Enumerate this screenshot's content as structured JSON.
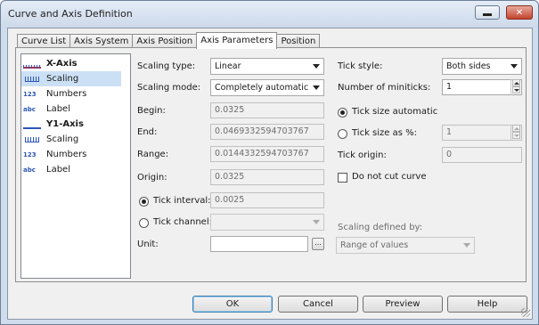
{
  "window": {
    "title": "Curve and Axis Definition"
  },
  "tabs": [
    {
      "label": "Curve List"
    },
    {
      "label": "Axis System"
    },
    {
      "label": "Axis Position"
    },
    {
      "label": "Axis Parameters"
    },
    {
      "label": "Position"
    }
  ],
  "tree": {
    "x_axis": "X-Axis",
    "x_scaling": "Scaling",
    "x_numbers": "Numbers",
    "x_label": "Label",
    "y1_axis": "Y1-Axis",
    "y1_scaling": "Scaling",
    "y1_numbers": "Numbers",
    "y1_label": "Label",
    "numbers_icon": "123",
    "label_icon": "abc"
  },
  "form": {
    "scaling_type_label": "Scaling type:",
    "scaling_type_value": "Linear",
    "scaling_mode_label": "Scaling mode:",
    "scaling_mode_value": "Completely automatic",
    "begin_label": "Begin:",
    "begin_value": "0.0325",
    "end_label": "End:",
    "end_value": "0.0469332594703767",
    "range_label": "Range:",
    "range_value": "0.0144332594703767",
    "origin_label": "Origin:",
    "origin_value": "0.0325",
    "tick_interval_label": "Tick interval:",
    "tick_interval_value": "0.0025",
    "tick_channel_label": "Tick channel:",
    "tick_channel_value": "",
    "unit_label": "Unit:",
    "unit_value": "",
    "unit_browse": "...",
    "tick_style_label": "Tick style:",
    "tick_style_value": "Both sides",
    "miniticks_label": "Number of miniticks:",
    "miniticks_value": "1",
    "tick_size_auto_label": "Tick size automatic",
    "tick_size_pct_label": "Tick size as %:",
    "tick_size_pct_value": "1",
    "tick_origin_label": "Tick origin:",
    "tick_origin_value": "0",
    "do_not_cut_label": "Do not cut curve",
    "scaling_defined_label": "Scaling defined by:",
    "scaling_defined_value": "Range of values"
  },
  "buttons": {
    "ok": "OK",
    "cancel": "Cancel",
    "preview": "Preview",
    "help": "Help"
  }
}
